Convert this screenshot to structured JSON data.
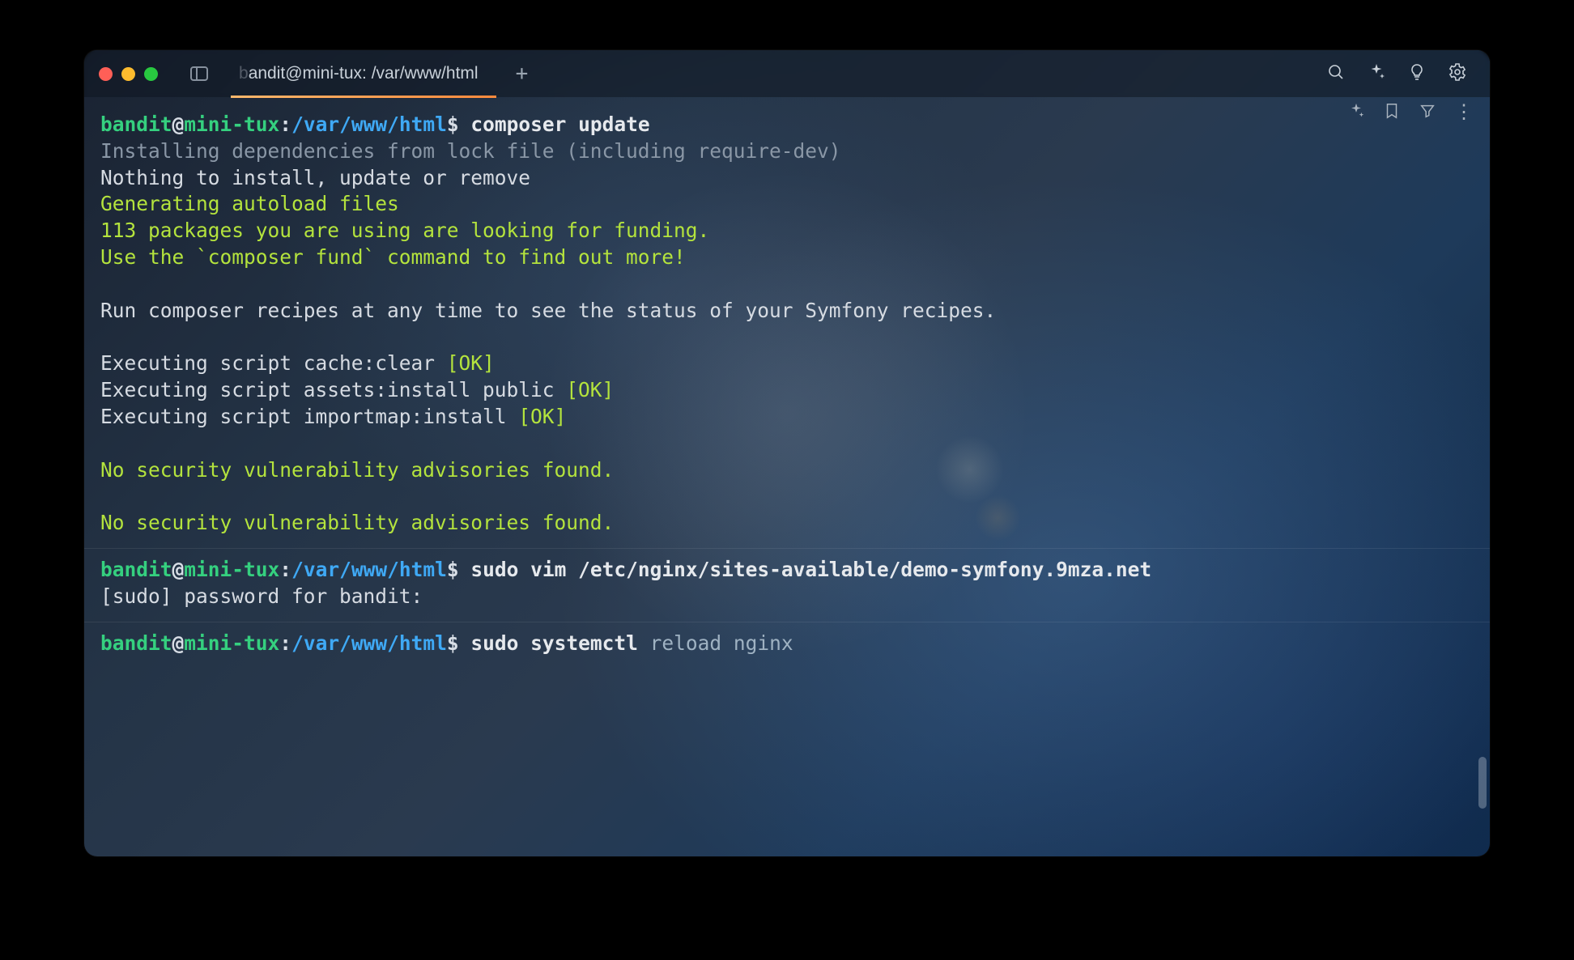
{
  "titlebar": {
    "tab_prefix_faded": "b",
    "tab_title": "andit@mini-tux: /var/www/html"
  },
  "prompt": {
    "user": "bandit",
    "host": "mini-tux",
    "path": "/var/www/html"
  },
  "blocks": [
    {
      "command": "composer update",
      "output": [
        {
          "cls": "out-dim",
          "text": "Installing dependencies from lock file (including require-dev)"
        },
        {
          "cls": "out-plain",
          "text": "Nothing to install, update or remove"
        },
        {
          "cls": "out-green",
          "text": "Generating autoload files"
        },
        {
          "cls": "out-green",
          "text": "113 packages you are using are looking for funding."
        },
        {
          "cls": "out-green",
          "text": "Use the `composer fund` command to find out more!"
        },
        {
          "cls": "",
          "text": ""
        },
        {
          "cls": "out-plain",
          "text": "Run composer recipes at any time to see the status of your Symfony recipes."
        },
        {
          "cls": "",
          "text": ""
        },
        {
          "text_pre": "Executing script cache:clear ",
          "ok": "[OK]"
        },
        {
          "text_pre": "Executing script assets:install public ",
          "ok": "[OK]"
        },
        {
          "text_pre": "Executing script importmap:install ",
          "ok": "[OK]"
        },
        {
          "cls": "",
          "text": ""
        },
        {
          "cls": "out-green",
          "text": "No security vulnerability advisories found."
        },
        {
          "cls": "",
          "text": ""
        },
        {
          "cls": "out-green",
          "text": "No security vulnerability advisories found."
        }
      ]
    },
    {
      "command_parts": {
        "sudo": "sudo",
        "cmd": "vim",
        "arg": "/etc/nginx/sites-available/demo-symfony.9mza.net"
      },
      "output": [
        {
          "cls": "out-plain",
          "text": "[sudo] password for bandit:"
        }
      ]
    },
    {
      "command_parts": {
        "sudo": "sudo",
        "cmd": "systemctl",
        "arg": "reload nginx"
      },
      "output": []
    }
  ]
}
